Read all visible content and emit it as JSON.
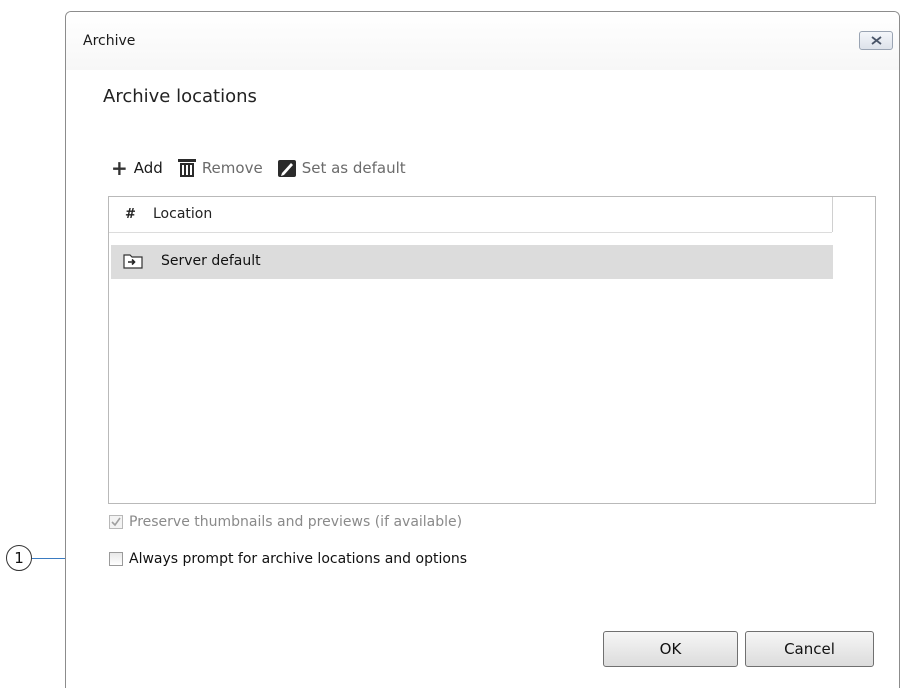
{
  "dialog": {
    "title": "Archive",
    "heading": "Archive locations"
  },
  "toolbar": {
    "add_label": "Add",
    "remove_label": "Remove",
    "set_default_label": "Set as default"
  },
  "table": {
    "columns": [
      "#",
      "Location"
    ],
    "rows": [
      {
        "location": "Server default",
        "icon": "folder-arrow-icon"
      }
    ]
  },
  "options": {
    "preserve_label": "Preserve thumbnails and previews (if available)",
    "preserve_checked": true,
    "preserve_enabled": false,
    "prompt_label": "Always prompt for archive locations and options",
    "prompt_checked": false
  },
  "buttons": {
    "ok": "OK",
    "cancel": "Cancel"
  },
  "callout": {
    "number": "1"
  }
}
